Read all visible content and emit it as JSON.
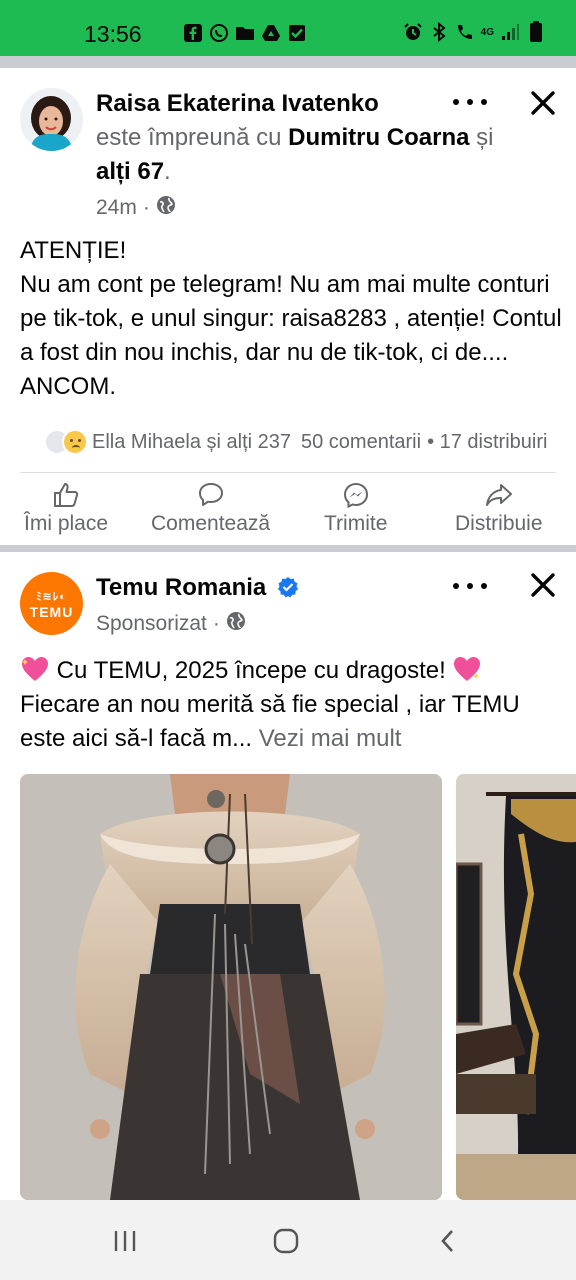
{
  "status_bar": {
    "time": "13:56",
    "network": "4G",
    "left_icons": [
      "facebook-icon",
      "whatsapp-icon",
      "folder-icon",
      "drive-icon",
      "checkbox-icon"
    ],
    "right_icons": [
      "alarm-icon",
      "bluetooth-icon",
      "call-icon",
      "signal-icon",
      "battery-icon"
    ]
  },
  "post1": {
    "author": "Raisa Ekaterina Ivatenko",
    "with_prefix": "este împreună cu",
    "with_first": "Dumitru",
    "with_second": "Coarna",
    "with_and": "și",
    "with_others": "alți 67",
    "with_period": ".",
    "time": "24m",
    "time_sep": "·",
    "body": "ATENȚIE!\nNu am cont pe telegram! Nu am mai multe conturi pe tik-tok, e unul singur: raisa8283 , atenție! Contul a fost din nou inchis, dar nu de tik-tok, ci de.... ANCOM.",
    "reactions_text": "Ella Mihaela și alți 237",
    "comments_text": "50 comentarii",
    "shares_text": "• 17 distribuiri",
    "actions": {
      "like": "Îmi place",
      "comment": "Comentează",
      "send": "Trimite",
      "share": "Distribuie"
    }
  },
  "post2": {
    "author": "Temu Romania",
    "logo_top": "ﾐ≋ﾚ◐",
    "logo_bottom": "TEMU",
    "sponsored": "Sponsorizat",
    "meta_sep": "·",
    "body_line1": "Cu TEMU, 2025 începe cu dragoste!",
    "body_rest": "Fiecare an nou merită să fie special , iar TEMU este aici să-l facă m...",
    "see_more": "Vezi mai mult"
  },
  "colors": {
    "status_green": "#1dbb52",
    "temu_orange": "#fb7701",
    "verified_blue": "#1877f2",
    "muted_text": "#65676b"
  }
}
